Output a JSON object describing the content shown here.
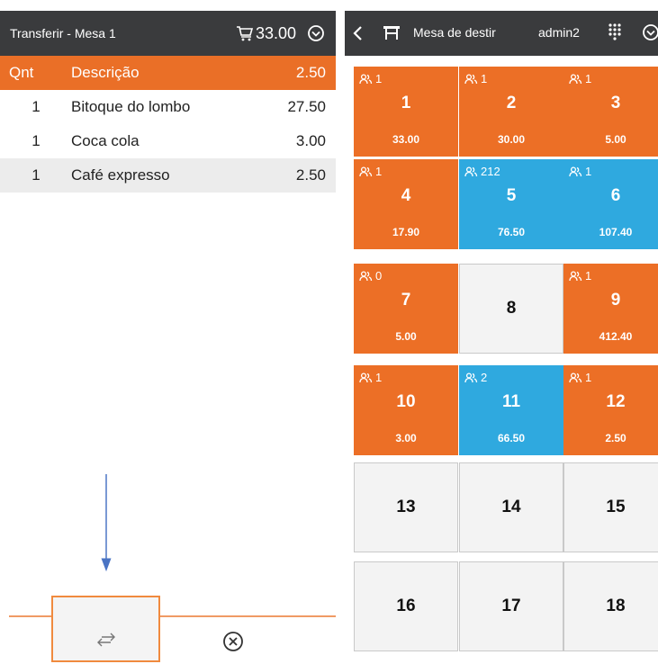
{
  "left": {
    "title": "Transferir - Mesa 1",
    "cart_total": "33.00",
    "columns": {
      "qty": "Qnt",
      "desc": "Descrição",
      "price": "2.50"
    },
    "items": [
      {
        "qty": "1",
        "desc": "Bitoque do lombo",
        "price": "27.50"
      },
      {
        "qty": "1",
        "desc": "Coca cola",
        "price": "3.00"
      },
      {
        "qty": "1",
        "desc": "Café expresso",
        "price": "2.50"
      }
    ]
  },
  "right": {
    "dest_label": "Mesa de destir",
    "user": "admin2",
    "tables": [
      {
        "num": "1",
        "pax": "1",
        "amount": "33.00",
        "state": "orange"
      },
      {
        "num": "2",
        "pax": "1",
        "amount": "30.00",
        "state": "orange"
      },
      {
        "num": "3",
        "pax": "1",
        "amount": "5.00",
        "state": "orange"
      },
      {
        "num": "4",
        "pax": "1",
        "amount": "17.90",
        "state": "orange"
      },
      {
        "num": "5",
        "pax": "212",
        "amount": "76.50",
        "state": "blue"
      },
      {
        "num": "6",
        "pax": "1",
        "amount": "107.40",
        "state": "blue"
      },
      {
        "num": "7",
        "pax": "0",
        "amount": "5.00",
        "state": "orange"
      },
      {
        "num": "8",
        "pax": "",
        "amount": "",
        "state": "empty"
      },
      {
        "num": "9",
        "pax": "1",
        "amount": "412.40",
        "state": "orange"
      },
      {
        "num": "10",
        "pax": "1",
        "amount": "3.00",
        "state": "orange"
      },
      {
        "num": "11",
        "pax": "2",
        "amount": "66.50",
        "state": "blue"
      },
      {
        "num": "12",
        "pax": "1",
        "amount": "2.50",
        "state": "orange"
      },
      {
        "num": "13",
        "pax": "",
        "amount": "",
        "state": "empty"
      },
      {
        "num": "14",
        "pax": "",
        "amount": "",
        "state": "empty"
      },
      {
        "num": "15",
        "pax": "",
        "amount": "",
        "state": "empty"
      },
      {
        "num": "16",
        "pax": "",
        "amount": "",
        "state": "empty"
      },
      {
        "num": "17",
        "pax": "",
        "amount": "",
        "state": "empty"
      },
      {
        "num": "18",
        "pax": "",
        "amount": "",
        "state": "empty"
      }
    ]
  },
  "icons": {
    "cart": "cart-icon",
    "chevron": "chevron-down-circle-icon",
    "back": "back-arrow-icon",
    "table": "table-icon",
    "grid": "grid-dots-icon",
    "transfer": "transfer-arrows-icon",
    "cancel": "cancel-circle-icon",
    "people": "people-icon"
  },
  "colors": {
    "header": "#3a3b3d",
    "accent": "#ec6f26",
    "occupied_blue": "#2fa9df",
    "empty": "#f3f3f3",
    "annotation_arrow": "#4a74c4"
  }
}
